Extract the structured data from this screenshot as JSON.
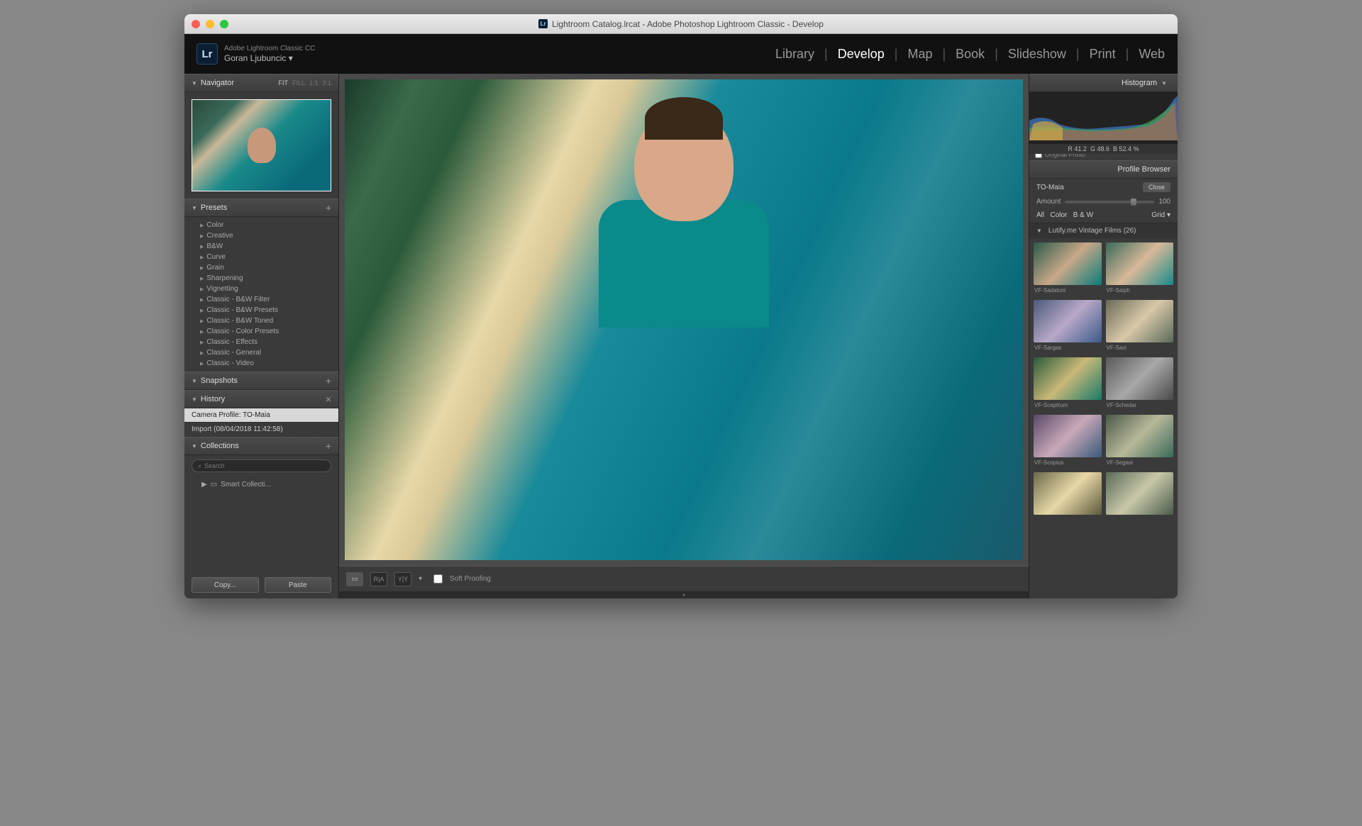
{
  "window_title": "Lightroom Catalog.lrcat - Adobe Photoshop Lightroom Classic - Develop",
  "brand": {
    "logo": "Lr",
    "app": "Adobe Lightroom Classic CC",
    "user": "Goran Ljubuncic"
  },
  "modules": [
    "Library",
    "Develop",
    "Map",
    "Book",
    "Slideshow",
    "Print",
    "Web"
  ],
  "active_module": "Develop",
  "left": {
    "navigator": {
      "title": "Navigator",
      "zoom": [
        "FIT",
        "FILL",
        "1:1",
        "3:1"
      ],
      "zoom_sel": "FIT"
    },
    "presets": {
      "title": "Presets",
      "items": [
        "Color",
        "Creative",
        "B&W",
        "Curve",
        "Grain",
        "Sharpening",
        "Vignetting",
        "Classic - B&W Filter",
        "Classic - B&W Presets",
        "Classic - B&W Toned",
        "Classic - Color Presets",
        "Classic - Effects",
        "Classic - General",
        "Classic - Video"
      ]
    },
    "snapshots": {
      "title": "Snapshots"
    },
    "history": {
      "title": "History",
      "items": [
        {
          "label": "Camera Profile: TO-Maia",
          "selected": true
        },
        {
          "label": "Import (08/04/2018 11:42:58)",
          "selected": false
        }
      ]
    },
    "collections": {
      "title": "Collections",
      "search": "Search",
      "smart": "Smart Collecti..."
    },
    "copy": "Copy...",
    "paste": "Paste"
  },
  "toolbar": {
    "soft_proofing": "Soft Proofing"
  },
  "right": {
    "histogram": {
      "title": "Histogram",
      "r": "41.2",
      "g": "48.6",
      "b": "52.4",
      "pct": "%",
      "original": "Original Photo"
    },
    "profile_browser": {
      "title": "Profile Browser",
      "profile": "TO-Maia",
      "close": "Close",
      "amount_label": "Amount",
      "amount_value": "100",
      "filters": [
        "All",
        "Color",
        "B & W"
      ],
      "view": "Grid",
      "group": "Lutify.me Vintage Films (26)",
      "thumbs": [
        "VF-Sadatoni",
        "VF-Saiph",
        "VF-Sargas",
        "VF-Savi",
        "VF-Sceptrum",
        "VF-Schedar",
        "VF-Scopius",
        "VF-Segasi",
        "",
        ""
      ]
    }
  }
}
